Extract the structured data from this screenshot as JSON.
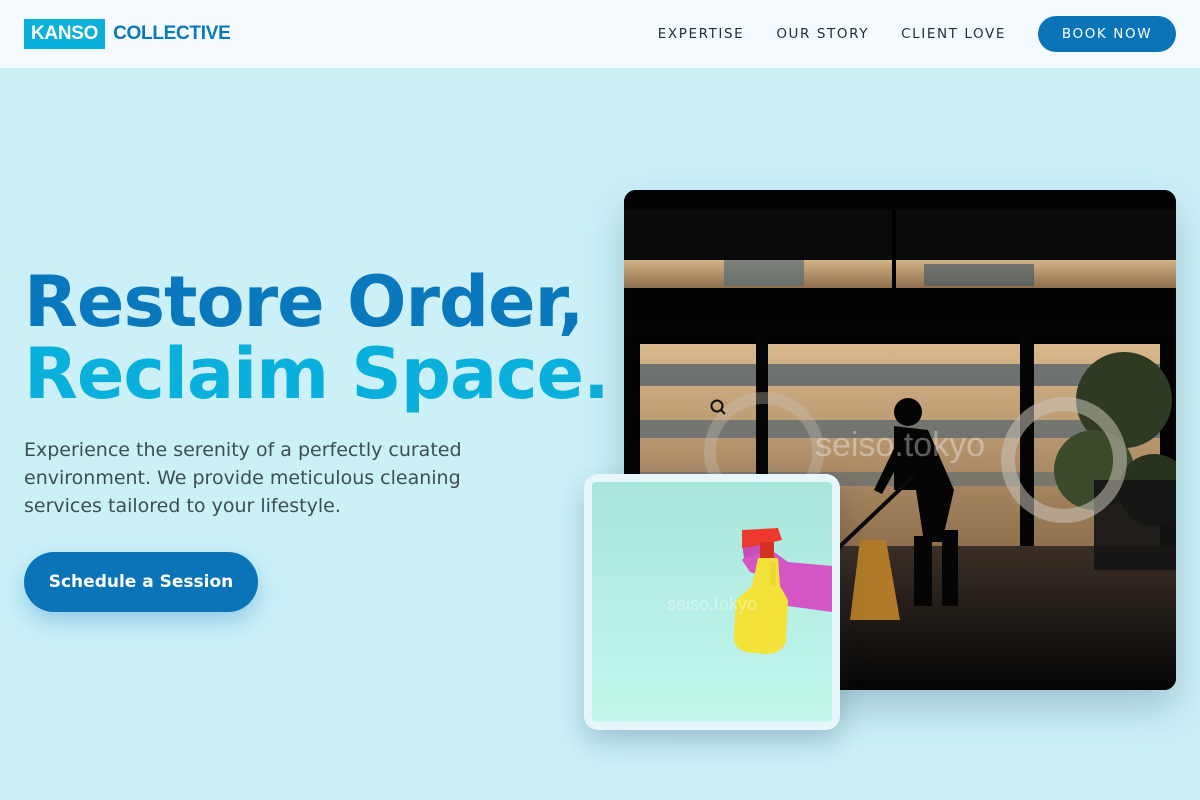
{
  "brand": {
    "logo_box": "KANSO",
    "logo_word": "COLLECTIVE"
  },
  "nav": {
    "links": [
      {
        "label": "EXPERTISE"
      },
      {
        "label": "OUR STORY"
      },
      {
        "label": "CLIENT LOVE"
      }
    ],
    "cta_label": "BOOK NOW"
  },
  "hero": {
    "title_line1": "Restore Order,",
    "title_line2": "Reclaim Space.",
    "subtitle": "Experience the serenity of a perfectly curated environment. We provide meticulous cleaning services tailored to your lifestyle.",
    "cta_label": "Schedule a Session"
  },
  "images": {
    "main_watermark": "seiso.tokyo",
    "small_watermark": "seiso.tokyo"
  },
  "colors": {
    "page_bg": "#cbf0f8",
    "nav_bg": "#f4fafd",
    "brand_blue": "#0a78bc",
    "brand_cyan": "#0ab0dc",
    "button_blue": "#0a74b8",
    "body_text": "#3c4d5a"
  }
}
